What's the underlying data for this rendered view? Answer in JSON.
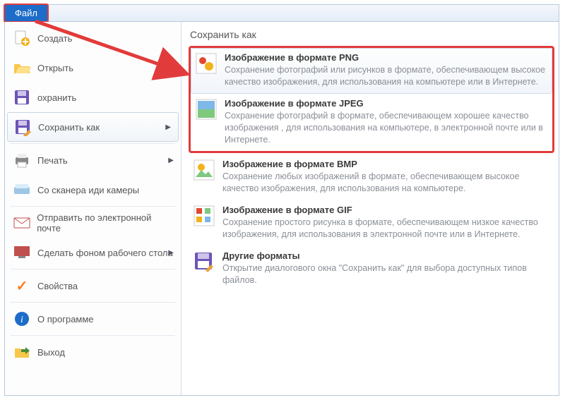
{
  "tab": {
    "file": "Файл"
  },
  "menu": {
    "create": "Создать",
    "open": "Открыть",
    "save": "охранить",
    "save_as": "Сохранить как",
    "print": "Печать",
    "scanner": "Со сканера иди камеры",
    "send_mail": "Отправить по электронной почте",
    "set_desktop": "Сделать фоном рабочего стола",
    "properties": "Свойства",
    "about": "О программе",
    "exit": "Выход"
  },
  "panel": {
    "title": "Сохранить как",
    "png": {
      "title": "Изображение в формате PNG",
      "desc": "Сохранение фотографий или рисунков в формате, обеспечивающем высокое качество изображения, для использования на компьютере или в Интернете."
    },
    "jpeg": {
      "title": "Изображение в формате JPEG",
      "desc": "Сохранение фотографий в формате, обеспечивающем хорошее качество изображения , для использования на компьютере, в электронной почте или в Интернете."
    },
    "bmp": {
      "title": "Изображение в формате BMP",
      "desc": "Сохранение любых изображений в формате, обеспечивающем высокое качество изображения, для использования на компьютере."
    },
    "gif": {
      "title": "Изображение в формате GIF",
      "desc": "Сохранение простого рисунка в формате, обеспечивающем низкое качество изображения, для использования в электронной почте или в Интернете."
    },
    "other": {
      "title": "Другие форматы",
      "desc": "Открытие диалогового окна \"Сохранить как\" для выбора доступных типов файлов."
    }
  }
}
